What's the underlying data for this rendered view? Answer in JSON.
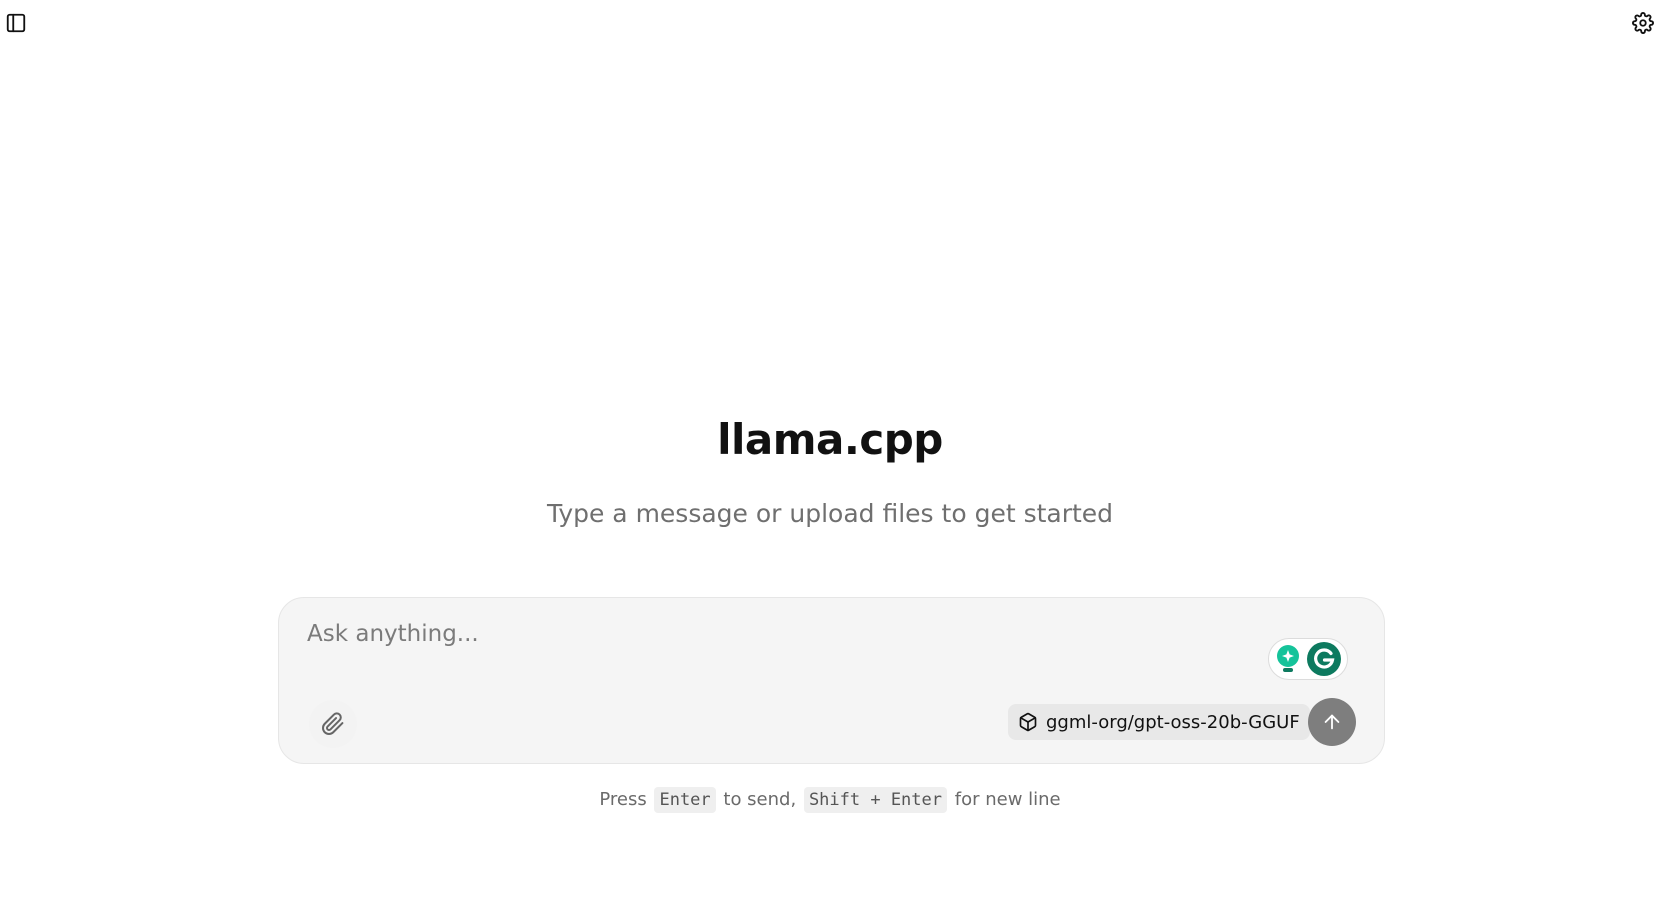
{
  "header": {
    "sidebar_toggle_icon": "sidebar-panel-icon",
    "settings_icon": "gear-icon"
  },
  "hero": {
    "title": "llama.cpp",
    "subtitle": "Type a message or upload files to get started"
  },
  "composer": {
    "placeholder": "Ask anything...",
    "value": "",
    "attach_icon": "paperclip-icon",
    "model_icon": "cube-icon",
    "model_name": "ggml-org/gpt-oss-20b-GGUF",
    "send_icon": "arrow-up-icon",
    "extension_icons": [
      "grammarly-bulb-icon",
      "grammarly-g-icon"
    ]
  },
  "hint": {
    "press": "Press",
    "key_send": "Enter",
    "to_send": "to send,",
    "key_newline": "Shift + Enter",
    "for_new_line": "for new line"
  },
  "colors": {
    "send_button": "#7e7e7e",
    "composer_bg": "#f5f5f5",
    "grammarly_green": "#15c39a",
    "grammarly_dark": "#0d7a5f"
  }
}
